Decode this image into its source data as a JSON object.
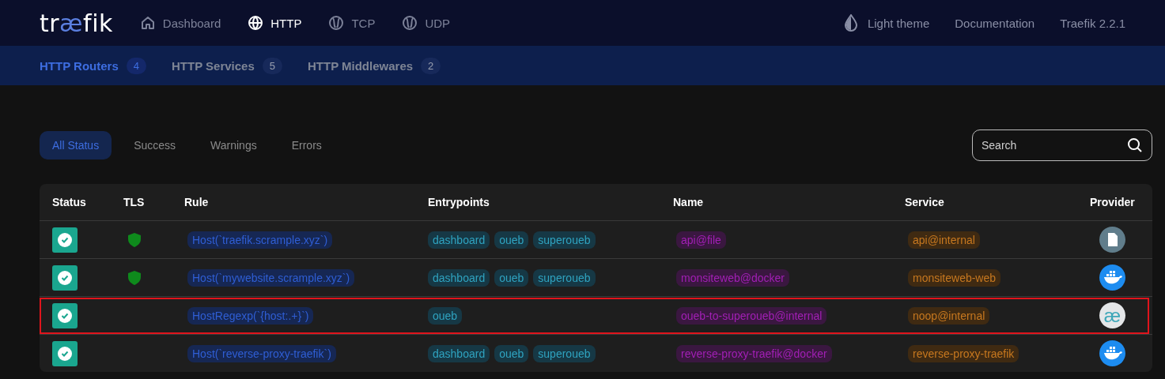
{
  "nav": {
    "logo": [
      {
        "text": "tr",
        "accent": false
      },
      {
        "text": "æ",
        "accent": true
      },
      {
        "text": "fik",
        "accent": false
      }
    ],
    "items": [
      {
        "label": "Dashboard",
        "kind": "home",
        "selected": false
      },
      {
        "label": "HTTP",
        "kind": "globe",
        "selected": true
      },
      {
        "label": "TCP",
        "kind": "ball",
        "selected": false
      },
      {
        "label": "UDP",
        "kind": "ball",
        "selected": false
      }
    ],
    "right": [
      {
        "label": "Light theme",
        "kind": "theme"
      },
      {
        "label": "Documentation",
        "kind": "link"
      },
      {
        "label": "Traefik 2.2.1",
        "kind": "link"
      }
    ]
  },
  "subnav": [
    {
      "label": "HTTP Routers",
      "count": "4",
      "selected": true
    },
    {
      "label": "HTTP Services",
      "count": "5",
      "selected": false
    },
    {
      "label": "HTTP Middlewares",
      "count": "2",
      "selected": false
    }
  ],
  "filters": [
    {
      "label": "All Status",
      "selected": true
    },
    {
      "label": "Success",
      "selected": false
    },
    {
      "label": "Warnings",
      "selected": false
    },
    {
      "label": "Errors",
      "selected": false
    }
  ],
  "search": {
    "placeholder": "Search"
  },
  "table": {
    "columns": [
      "Status",
      "TLS",
      "Rule",
      "Entrypoints",
      "Name",
      "Service",
      "Provider"
    ],
    "rows": [
      {
        "success": true,
        "tls": true,
        "rule": "Host(`traefik.scrample.xyz`)",
        "entrypoints": [
          "dashboard",
          "oueb",
          "superoueb"
        ],
        "name": "api@file",
        "service": "api@internal",
        "provider": {
          "kind": "file"
        },
        "highlighted": false
      },
      {
        "success": true,
        "tls": true,
        "rule": "Host(`mywebsite.scrample.xyz`)",
        "entrypoints": [
          "dashboard",
          "oueb",
          "superoueb"
        ],
        "name": "monsiteweb@docker",
        "service": "monsiteweb-web",
        "provider": {
          "kind": "docker"
        },
        "highlighted": false
      },
      {
        "success": true,
        "tls": false,
        "rule": "HostRegexp(`{host:.+}`)",
        "entrypoints": [
          "oueb"
        ],
        "name": "oueb-to-superoueb@internal",
        "service": "noop@internal",
        "provider": {
          "kind": "internal",
          "glyph": "æ"
        },
        "highlighted": true
      },
      {
        "success": true,
        "tls": false,
        "rule": "Host(`reverse-proxy-traefik`)",
        "entrypoints": [
          "dashboard",
          "oueb",
          "superoueb"
        ],
        "name": "reverse-proxy-traefik@docker",
        "service": "reverse-proxy-traefik",
        "provider": {
          "kind": "docker"
        },
        "highlighted": false
      }
    ]
  }
}
